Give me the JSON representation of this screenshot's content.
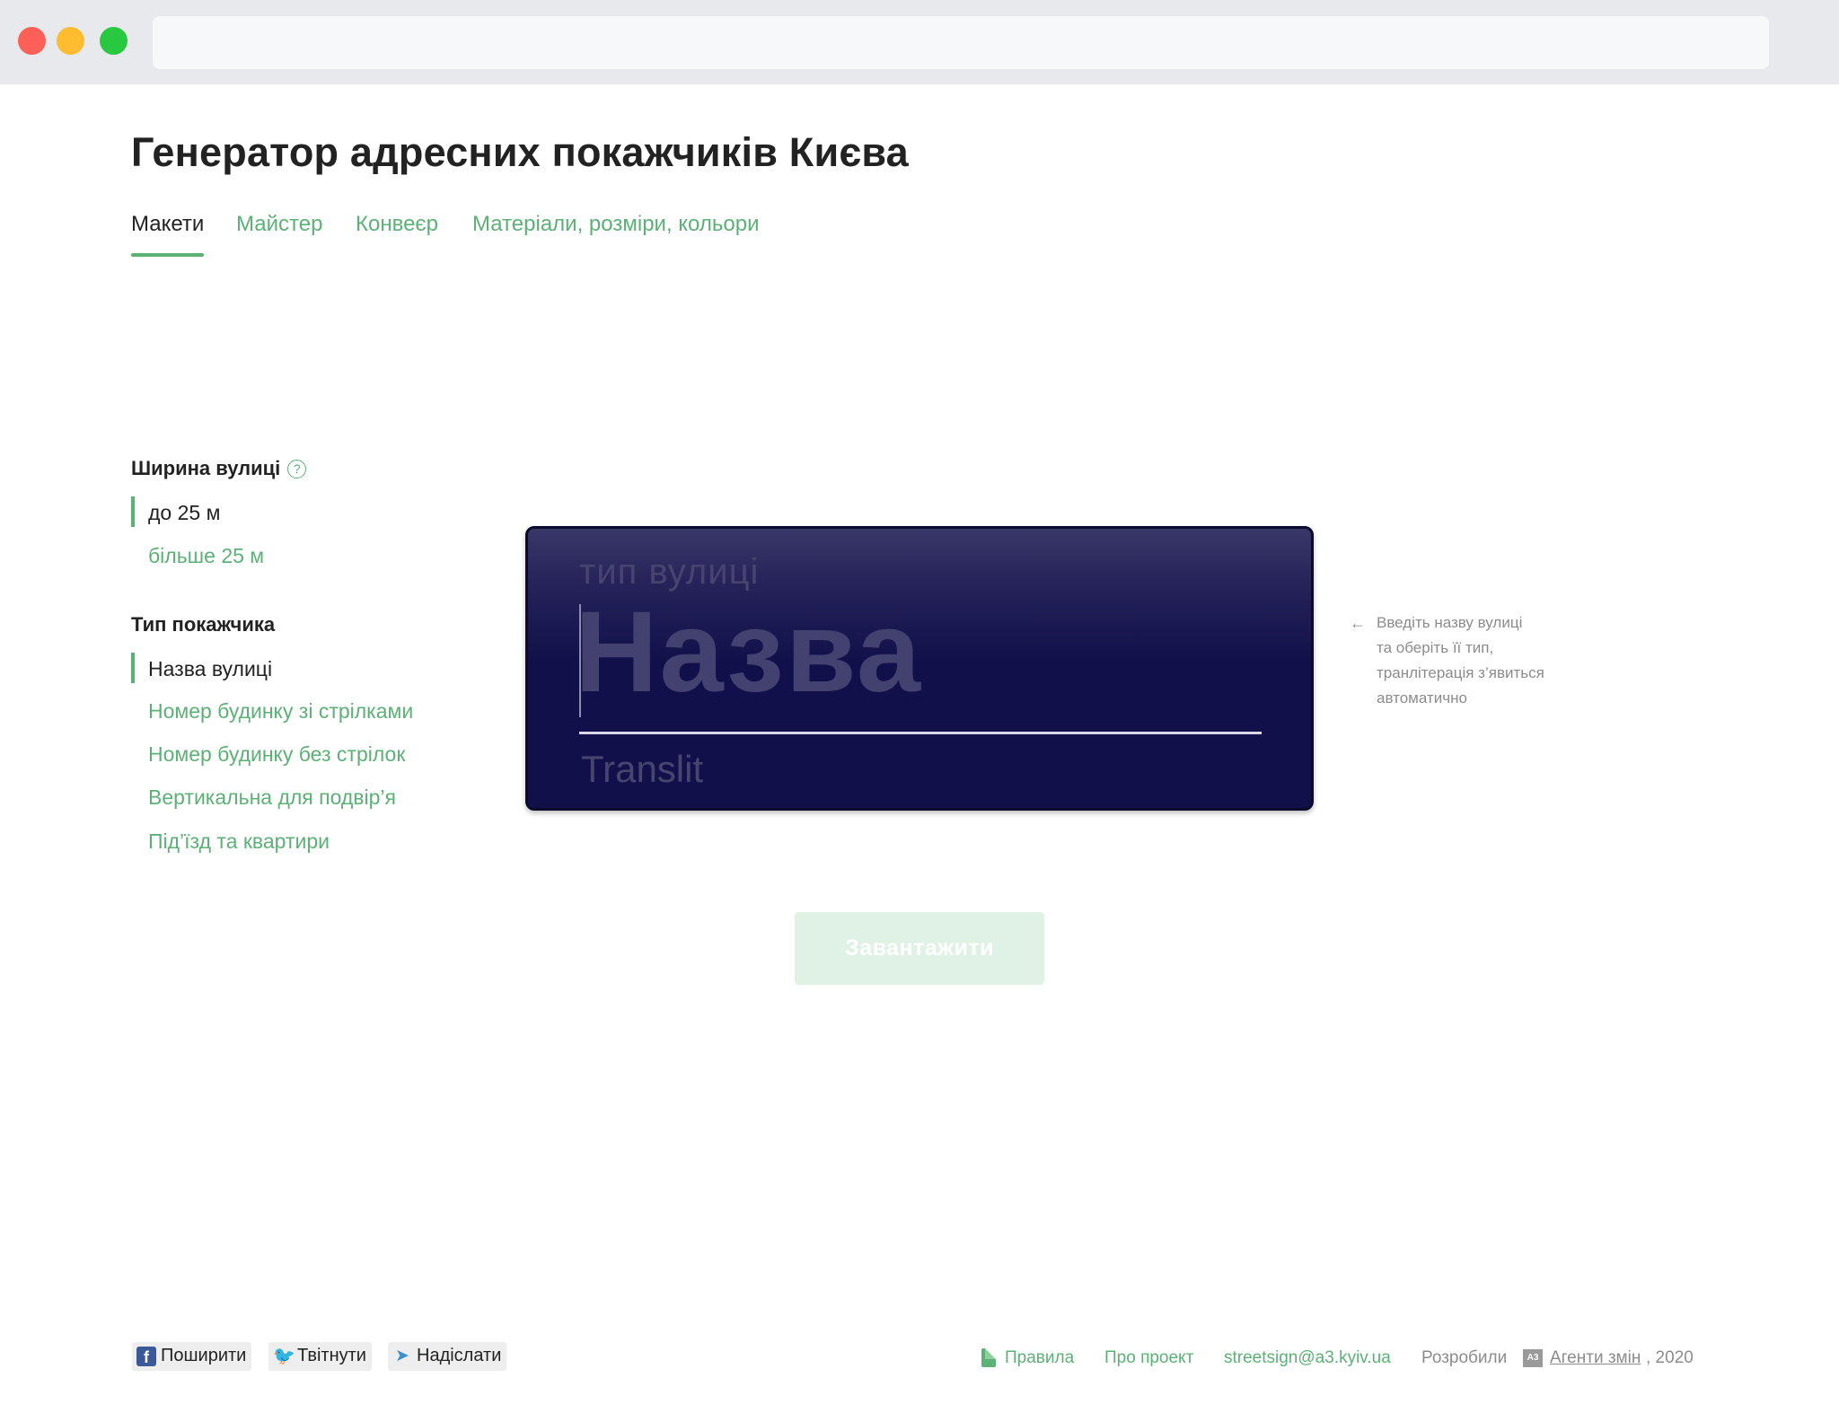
{
  "page": {
    "title": "Генератор адресних покажчиків Києва",
    "tabs": [
      {
        "label": "Макети",
        "active": true
      },
      {
        "label": "Майстер",
        "active": false
      },
      {
        "label": "Конвеєр",
        "active": false
      },
      {
        "label": "Матеріали, розміри, кольори",
        "active": false
      }
    ]
  },
  "controls": {
    "width_group": {
      "title": "Ширина вулиці",
      "help_icon": "question-circle-icon",
      "options": [
        {
          "label": "до 25 м",
          "selected": true
        },
        {
          "label": "більше 25 м",
          "selected": false
        }
      ]
    },
    "type_group": {
      "title": "Тип покажчика",
      "options": [
        {
          "label": "Назва вулиці",
          "selected": true
        },
        {
          "label": "Номер будинку зі стрілками",
          "selected": false
        },
        {
          "label": "Номер будинку без стрілок",
          "selected": false
        },
        {
          "label": "Вертикальна для подвір’я",
          "selected": false
        },
        {
          "label": "Під’їзд та квартири",
          "selected": false
        }
      ]
    }
  },
  "sign": {
    "type_placeholder": "тип вулиці",
    "name_placeholder": "Назва",
    "translit_placeholder": "Translit",
    "background_color": "#12104a"
  },
  "hint": {
    "arrow_icon": "arrow-left-icon",
    "text_lines": [
      "Введіть назву вулиці",
      "та оберіть її тип,",
      "транлітерація з’явиться",
      "автоматично"
    ]
  },
  "download_button": {
    "label": "Завантажити",
    "disabled": true
  },
  "footer": {
    "share": [
      {
        "label": "Поширити",
        "icon": "facebook-icon"
      },
      {
        "label": "Твітнути",
        "icon": "twitter-icon"
      },
      {
        "label": "Надіслати",
        "icon": "telegram-icon"
      }
    ],
    "rules_label": "Правила",
    "about_label": "Про проект",
    "email": "streetsign@a3.kyiv.ua",
    "developed_by": "Розробили",
    "agency": "Агенти змін",
    "year": ", 2020"
  },
  "colors": {
    "accent": "#5cb176",
    "text": "#222222",
    "muted": "#8c8c8c"
  }
}
